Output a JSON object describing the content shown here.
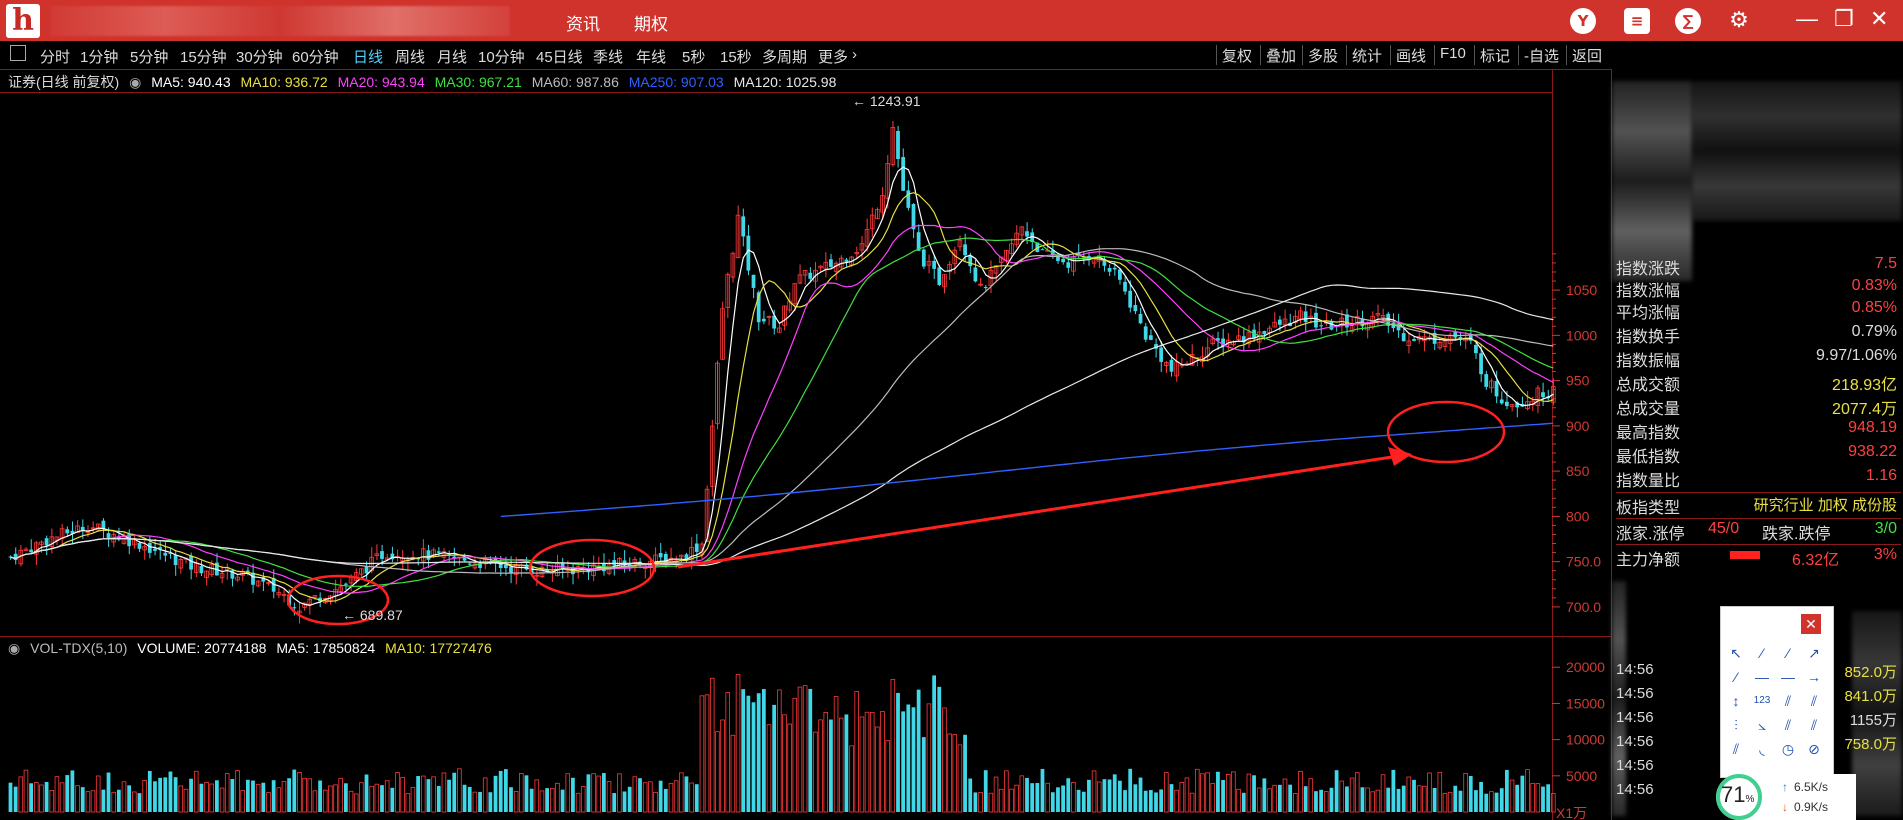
{
  "topbar": {
    "nav": [
      "资讯",
      "期权"
    ],
    "icons": [
      "Y",
      "≡",
      "∑",
      "⚙"
    ],
    "window_controls": [
      "—",
      "❐",
      "✕"
    ]
  },
  "periods": [
    "分时",
    "1分钟",
    "5分钟",
    "15分钟",
    "30分钟",
    "60分钟",
    "日线",
    "周线",
    "月线",
    "10分钟",
    "45日线",
    "季线",
    "年线",
    "5秒",
    "15秒",
    "多周期",
    "更多"
  ],
  "active_period": "日线",
  "toolbar": [
    "复权",
    "叠加",
    "多股",
    "统计",
    "画线",
    "F10",
    "标记",
    "-自选",
    "返回"
  ],
  "chart_title": "证券(日线 前复权)",
  "ma_legend": [
    {
      "label": "MA5: 940.43",
      "color": "#ffffff"
    },
    {
      "label": "MA10: 936.72",
      "color": "#e8e040"
    },
    {
      "label": "MA20: 943.94",
      "color": "#ff40ff"
    },
    {
      "label": "MA30: 967.21",
      "color": "#40e040"
    },
    {
      "label": "MA60: 987.86",
      "color": "#bcbcbc"
    },
    {
      "label": "MA250: 907.03",
      "color": "#3060ff"
    },
    {
      "label": "MA120: 1025.98",
      "color": "#e8e8e8"
    }
  ],
  "vol_legend": [
    {
      "label": "VOL-TDX(5,10)",
      "color": "#bcbcbc"
    },
    {
      "label": "VOLUME: 20774188",
      "color": "#ffffff"
    },
    {
      "label": "MA5: 17850824",
      "color": "#ffffff"
    },
    {
      "label": "MA10: 17727476",
      "color": "#e8e040"
    }
  ],
  "price_axis": [
    "1050",
    "1000",
    "950",
    "900",
    "850",
    "800",
    "750.0",
    "700.0"
  ],
  "volume_axis": [
    "20000",
    "15000",
    "10000",
    "5000"
  ],
  "volume_unit": "X1万",
  "annotations": {
    "high": "1243.91",
    "low": "689.87"
  },
  "chart_data": {
    "type": "candlestick",
    "high": 1243.91,
    "low": 689.87,
    "ylim_price": [
      680,
      1260
    ],
    "ylim_volume": [
      0,
      21000
    ],
    "ma": {
      "MA5": 940.43,
      "MA10": 936.72,
      "MA20": 943.94,
      "MA30": 967.21,
      "MA60": 987.86,
      "MA250": 907.03,
      "MA120": 1025.98
    },
    "volume": {
      "VOLUME": 20774188,
      "MA5": 17850824,
      "MA10": 17727476
    }
  },
  "stats": [
    {
      "label": "指数涨跌",
      "value": "7.5",
      "color": "#ff4040"
    },
    {
      "label": "指数涨幅",
      "value": "0.83%",
      "color": "#ff4040"
    },
    {
      "label": "平均涨幅",
      "value": "0.85%",
      "color": "#ff4040"
    },
    {
      "label": "指数换手",
      "value": "0.79%",
      "color": "#dcdcdc"
    },
    {
      "label": "指数振幅",
      "value": "9.97/1.06%",
      "color": "#dcdcdc"
    },
    {
      "label": "总成交额",
      "value": "218.93亿",
      "color": "#e8e040"
    },
    {
      "label": "总成交量",
      "value": "2077.4万",
      "color": "#e8e040"
    },
    {
      "label": "最高指数",
      "value": "948.19",
      "color": "#ff4040"
    },
    {
      "label": "最低指数",
      "value": "938.22",
      "color": "#ff4040"
    },
    {
      "label": "指数量比",
      "value": "1.16",
      "color": "#ff4040"
    }
  ],
  "sector": {
    "label": "板指类型",
    "value": "研究行业 加权 成份股"
  },
  "updown": {
    "label1": "涨家.涨停",
    "v1": "45/0",
    "label2": "跌家.跌停",
    "v2": "3/0"
  },
  "mainforce": {
    "label": "主力净额",
    "value": "6.32亿",
    "pct": "3%"
  },
  "ticks": [
    {
      "time": "14:56",
      "vol": "852.0万"
    },
    {
      "time": "14:56",
      "vol": "841.0万"
    },
    {
      "time": "14:56",
      "vol": "1155万"
    },
    {
      "time": "14:56",
      "vol": "758.0万"
    },
    {
      "time": "14:56",
      "vol": ""
    },
    {
      "time": "14:56",
      "vol": ""
    }
  ],
  "network": {
    "percent": "71",
    "unit": "%",
    "up": "6.5K/s",
    "down": "0.9K/s"
  }
}
